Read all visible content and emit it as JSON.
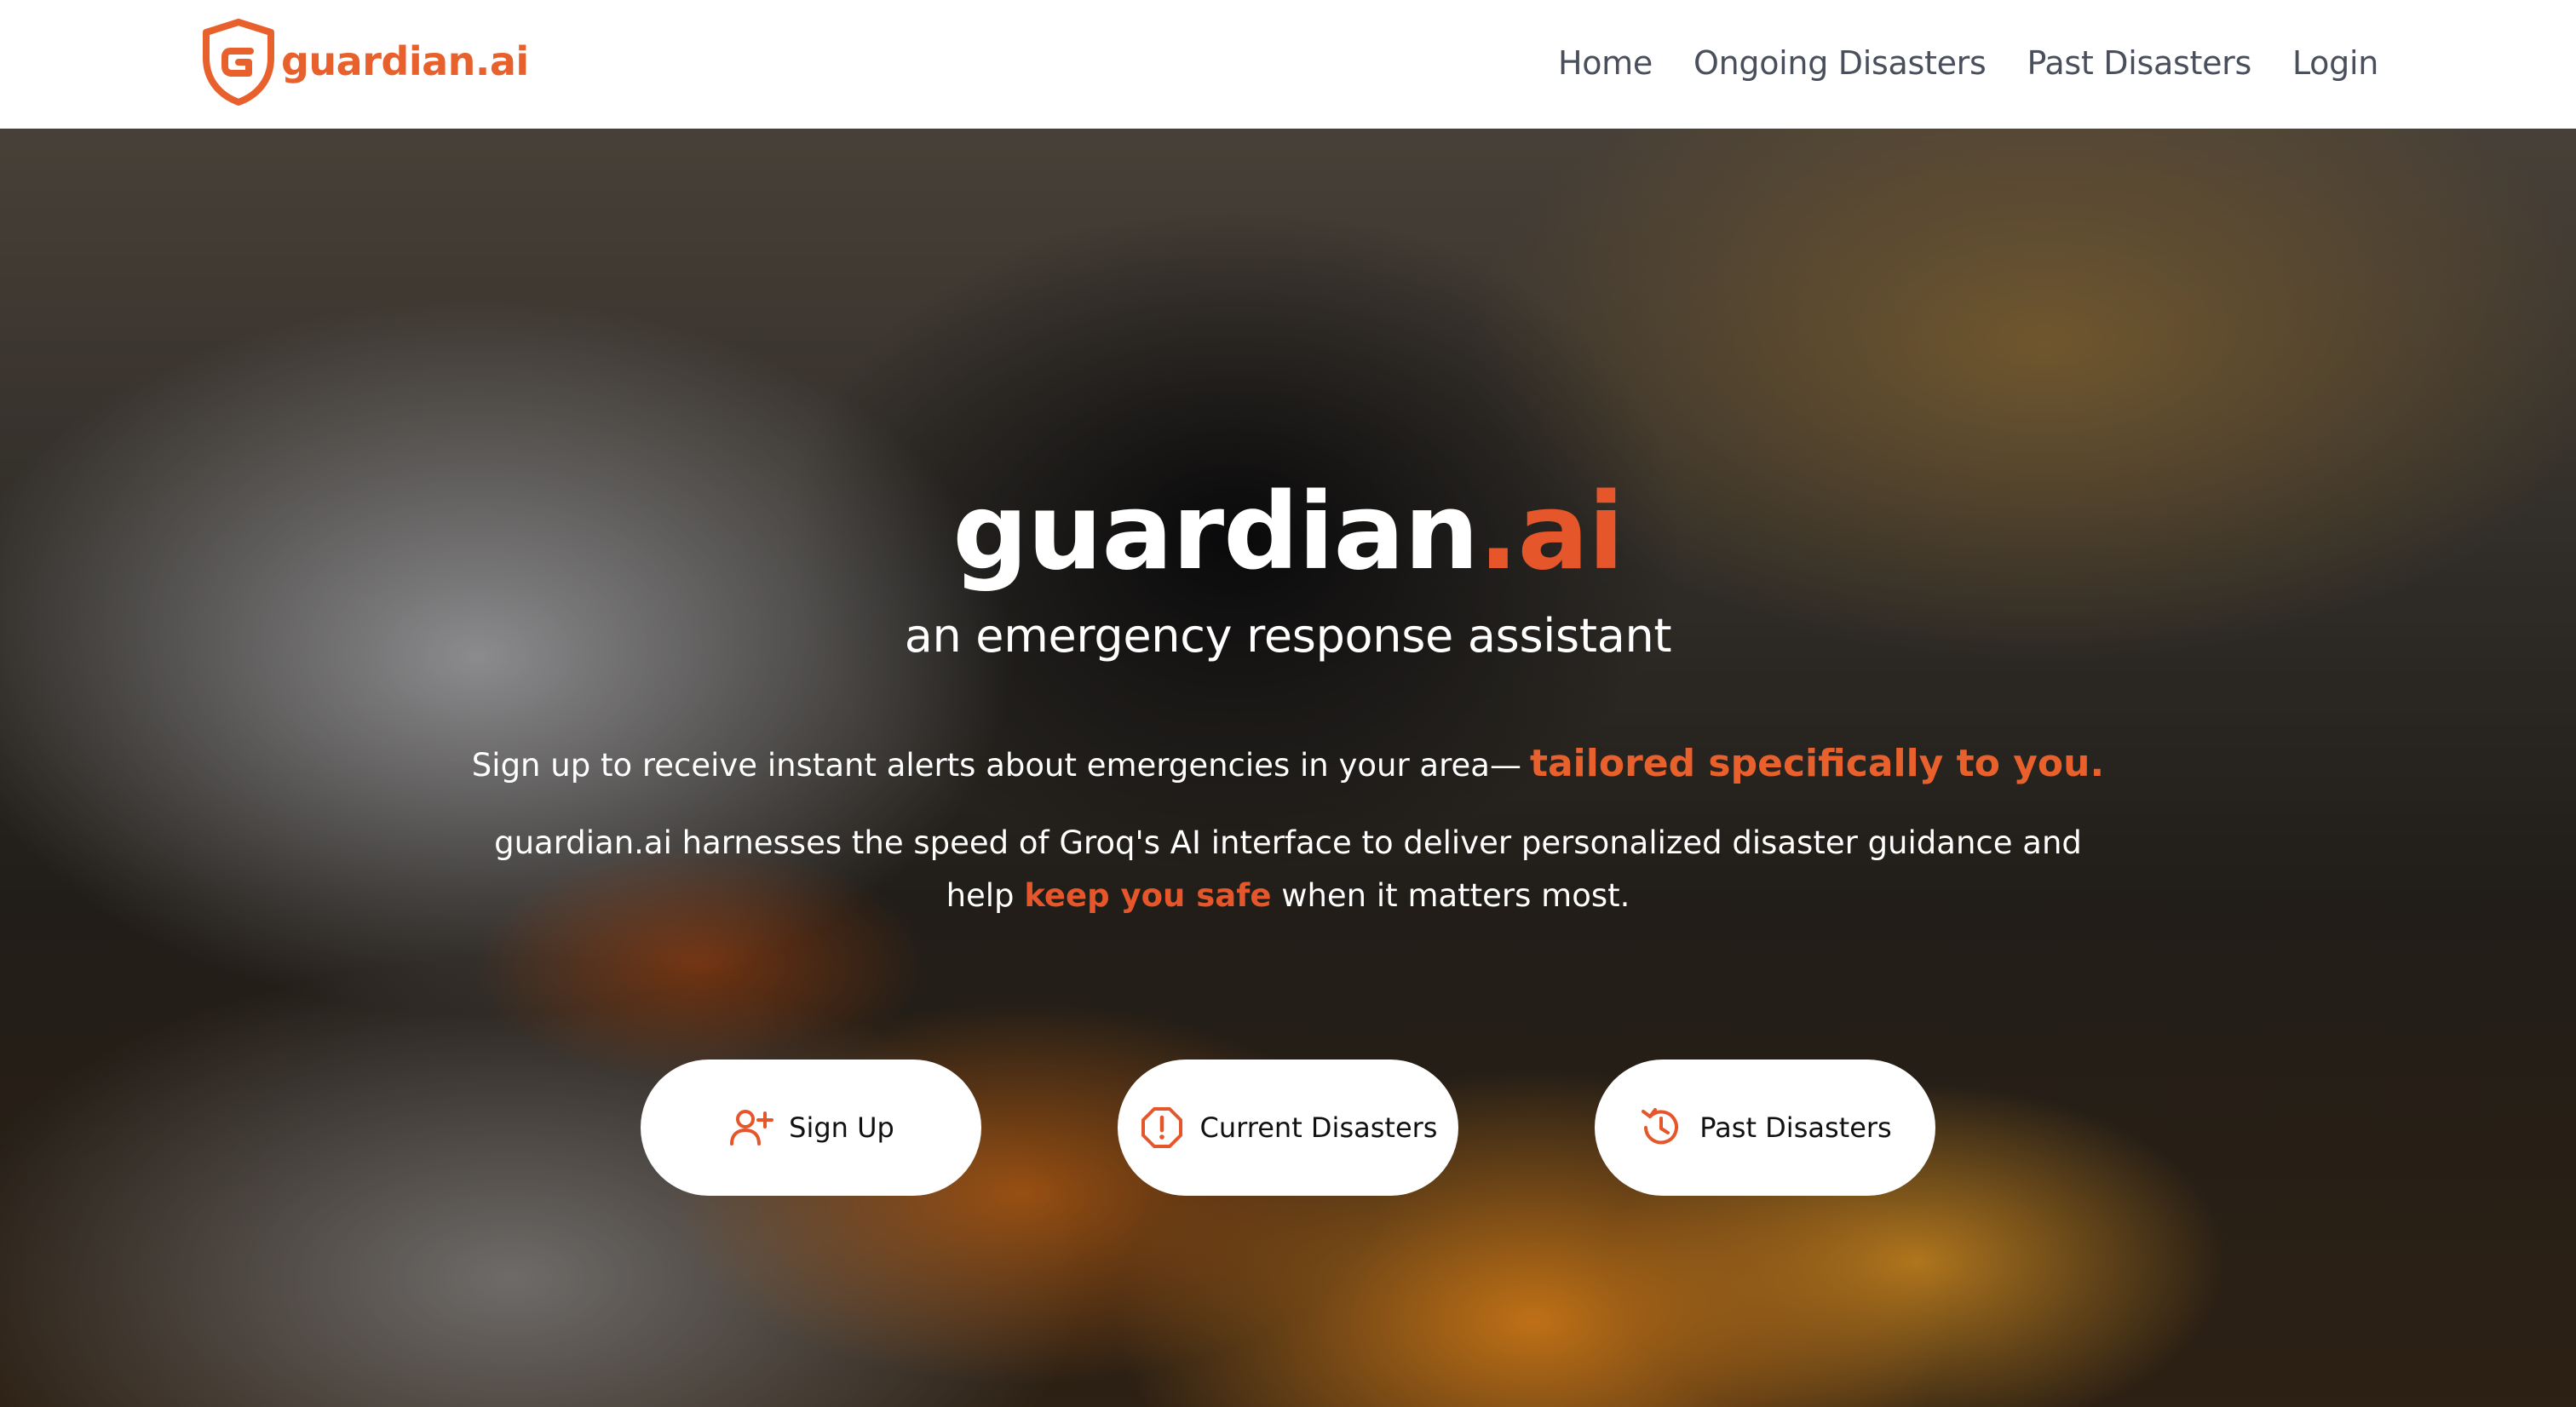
{
  "brand": {
    "name": "guardian.ai",
    "accent_color": "#e8612c",
    "logo_icon": "shield-icon"
  },
  "nav": {
    "items": [
      {
        "label": "Home"
      },
      {
        "label": "Ongoing Disasters"
      },
      {
        "label": "Past Disasters"
      },
      {
        "label": "Login"
      }
    ]
  },
  "hero": {
    "title_main": "guardian",
    "title_accent": ".ai",
    "subtitle": "an emergency response assistant",
    "tagline_text": "Sign up to receive instant alerts about emergencies in your area—",
    "tagline_accent": "tailored specifically to you.",
    "description_text": "guardian.ai harnesses the speed of Groq's AI interface to deliver personalized disaster guidance and help",
    "description_accent": "keep you safe",
    "description_end": "when it matters most.",
    "background": "wildfire-smoke-image",
    "buttons": [
      {
        "label": "Sign Up",
        "icon": "add-user-icon"
      },
      {
        "label": "Current Disasters",
        "icon": "alert-octagon-icon"
      },
      {
        "label": "Past Disasters",
        "icon": "history-icon"
      }
    ]
  },
  "colors": {
    "accent": "#e5572b",
    "nav_text": "#4a4f5c",
    "white": "#ffffff"
  }
}
